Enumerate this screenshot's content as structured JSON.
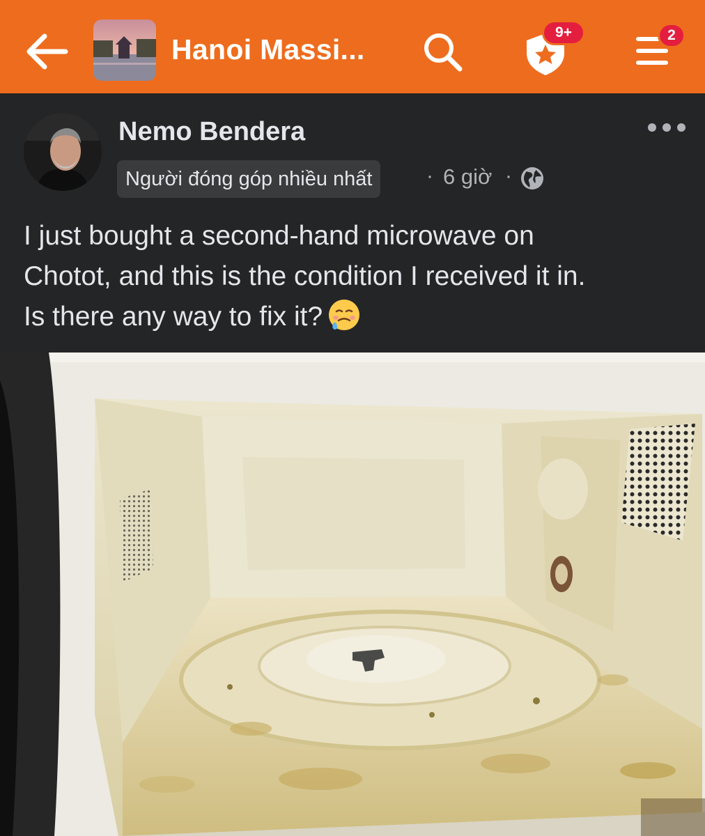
{
  "topbar": {
    "group_title": "Hanoi Massi...",
    "back_icon": "arrow-left-icon",
    "search_icon": "search-icon",
    "shield_icon": "shield-star-icon",
    "menu_icon": "menu-icon",
    "notifications_badge": "9+",
    "menu_badge": "2",
    "bar_color": "#ee6c1d",
    "badge_color": "#e41e3f"
  },
  "post": {
    "author": "Nemo Bendera",
    "contributor_badge": "Người đóng góp nhiều nhất",
    "separator": "·",
    "time": "6 giờ",
    "audience_icon": "globe-icon",
    "more_icon": "more-dots-icon",
    "text_lines": [
      "I just bought a second-hand microwave on",
      "Chotot, and this is the condition I received it in.",
      "Is there any way to fix it?"
    ],
    "emoji_icon": "face-holding-back-tears-icon",
    "photo_subject": "dirty-microwave-interior-photo"
  }
}
